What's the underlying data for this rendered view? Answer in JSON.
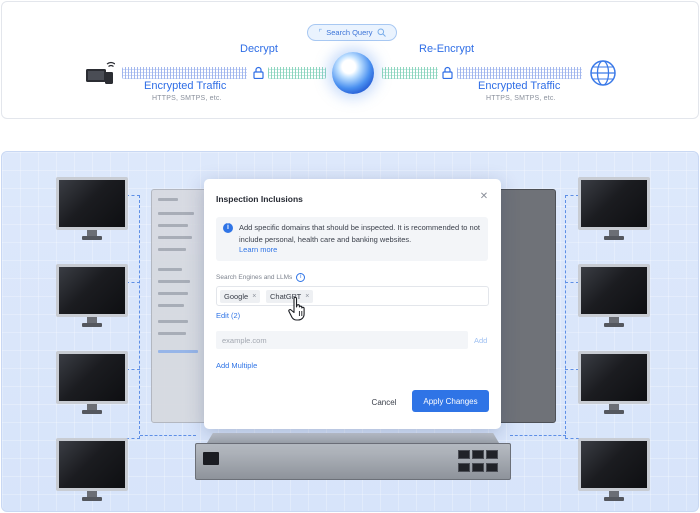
{
  "flow": {
    "search_query_label": "Search Query",
    "decrypt_label": "Decrypt",
    "re_encrypt_label": "Re-Encrypt",
    "left_traffic_title": "Encrypted Traffic",
    "left_traffic_sub": "HTTPS, SMTPS, etc.",
    "right_traffic_title": "Encrypted Traffic",
    "right_traffic_sub": "HTTPS, SMTPS, etc."
  },
  "modal": {
    "title": "Inspection Inclusions",
    "info_text": "Add specific domains that should be inspected. It is recommended to not include personal, health care and banking websites.",
    "learn_more": "Learn more",
    "field_label": "Search Engines and LLMs",
    "tags": [
      {
        "label": "Google"
      },
      {
        "label": "ChatGPT"
      }
    ],
    "tag_remove_glyph": "×",
    "edit_link": "Edit (2)",
    "domain_input": {
      "value": "",
      "placeholder": "example.com"
    },
    "add_label": "Add",
    "add_multiple_label": "Add Multiple",
    "cancel_label": "Cancel",
    "apply_label": "Apply Changes",
    "close_glyph": "✕",
    "info_glyph": "i",
    "help_glyph": "i"
  },
  "colors": {
    "accent": "#2f74e6",
    "scene_bg": "#d7e4fa",
    "dashed_links": "#5e8fe6"
  },
  "icons": [
    "wifi-device-icon",
    "lock-icon",
    "search-icon",
    "ai-orb-icon",
    "globe-icon",
    "info-icon",
    "close-icon",
    "pointer-hand-icon"
  ]
}
